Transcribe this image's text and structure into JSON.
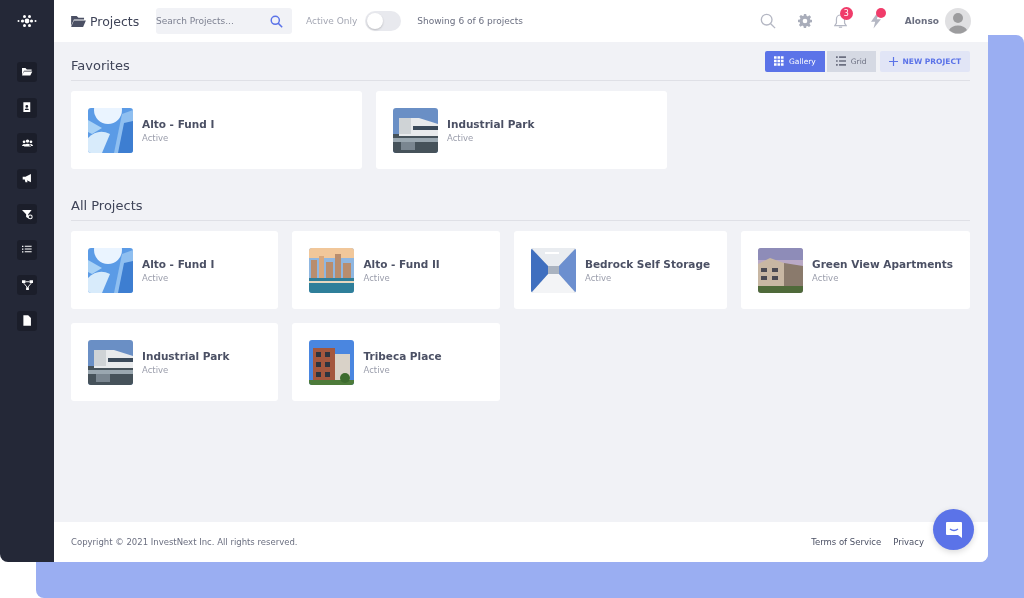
{
  "header": {
    "title": "Projects",
    "search": {
      "placeholder": "Search Projects..."
    },
    "filter": {
      "label": "Active Only",
      "on": false
    },
    "count": "Showing 6 of 6 projects",
    "notifications": "3",
    "user": "Alonso"
  },
  "sidebar": {
    "items": [
      {
        "kind": "folder"
      },
      {
        "kind": "contact"
      },
      {
        "kind": "users"
      },
      {
        "kind": "megaphone"
      },
      {
        "kind": "filter"
      },
      {
        "kind": "list"
      },
      {
        "kind": "network"
      },
      {
        "kind": "file"
      }
    ]
  },
  "views": [
    {
      "label": "Gallery",
      "selected": true,
      "kind": "gallery"
    },
    {
      "label": "Grid",
      "selected": false,
      "kind": "grid"
    }
  ],
  "new_project": "NEW PROJECT",
  "sections": [
    {
      "title": "Favorites",
      "projects": [
        {
          "name": "Alto - Fund I",
          "status": "Active"
        },
        {
          "name": "Industrial Park",
          "status": "Active"
        }
      ]
    },
    {
      "title": "All Projects",
      "projects": [
        {
          "name": "Alto - Fund I",
          "status": "Active"
        },
        {
          "name": "Alto - Fund II",
          "status": "Active"
        },
        {
          "name": "Bedrock Self Storage",
          "status": "Active"
        },
        {
          "name": "Green View Apartments",
          "status": "Active"
        },
        {
          "name": "Industrial Park",
          "status": "Active"
        },
        {
          "name": "Tribeca Place",
          "status": "Active"
        }
      ]
    }
  ],
  "footer": {
    "copyright": "Copyright © 2021 InvestNext Inc. All rights reserved.",
    "links": [
      "Terms of Service",
      "Privacy"
    ]
  }
}
